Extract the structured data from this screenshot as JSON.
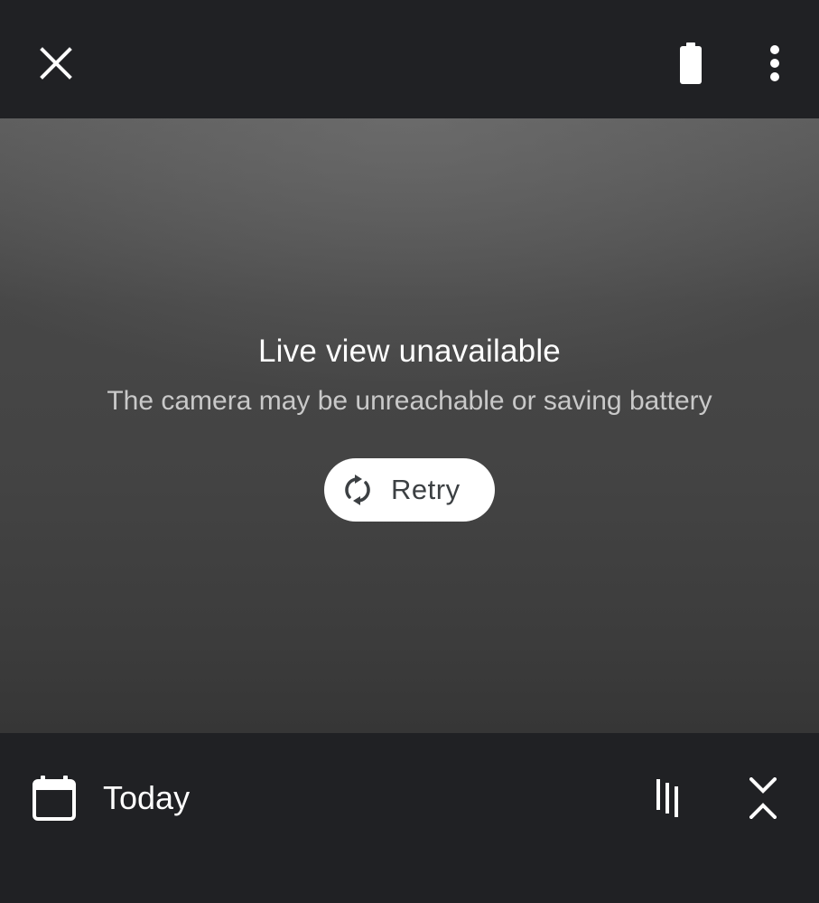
{
  "top_bar": {
    "close_icon": "close-icon",
    "battery_icon": "battery-full-icon",
    "more_icon": "more-vert-icon"
  },
  "live_view": {
    "title": "Live view unavailable",
    "subtitle": "The camera may be unreachable or saving battery",
    "retry_label": "Retry",
    "retry_icon": "refresh-icon"
  },
  "bottom_bar": {
    "date_label": "Today",
    "calendar_icon": "calendar-icon",
    "timeline_icon": "timeline-icon",
    "expand_icon": "collapse-expand-icon"
  },
  "colors": {
    "background": "#202124",
    "text_primary": "#ffffff",
    "text_secondary": "#c9c9c9",
    "button_bg": "#ffffff",
    "button_text": "#3c4043"
  }
}
